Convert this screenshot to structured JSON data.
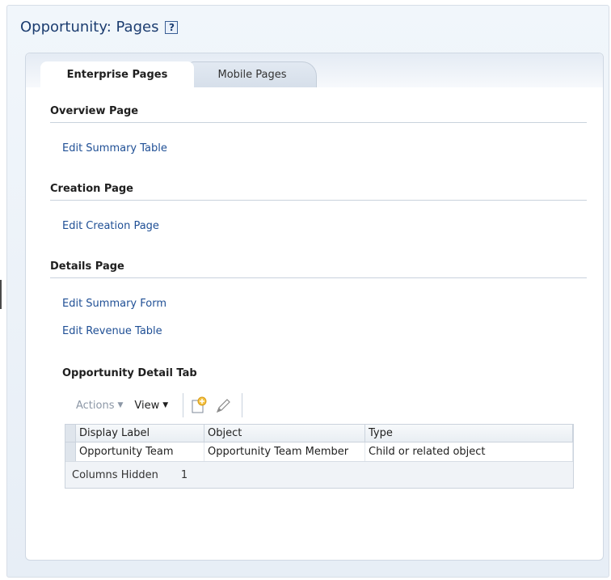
{
  "page": {
    "title": "Opportunity: Pages",
    "help_icon": "?"
  },
  "tabs": [
    {
      "label": "Enterprise Pages",
      "active": true
    },
    {
      "label": "Mobile Pages",
      "active": false
    }
  ],
  "sections": {
    "overview": {
      "title": "Overview Page",
      "links": [
        "Edit Summary Table"
      ]
    },
    "creation": {
      "title": "Creation Page",
      "links": [
        "Edit Creation Page"
      ]
    },
    "details": {
      "title": "Details Page",
      "links": [
        "Edit Summary Form",
        "Edit Revenue Table"
      ],
      "subsection_title": "Opportunity Detail Tab"
    }
  },
  "toolbar": {
    "actions_label": "Actions",
    "view_label": "View",
    "icons": [
      "create-icon",
      "edit-pencil-icon"
    ]
  },
  "table": {
    "columns": [
      "Display Label",
      "Object",
      "Type"
    ],
    "rows": [
      [
        "Opportunity Team",
        "Opportunity Team Member",
        "Child or related object"
      ]
    ],
    "footer": {
      "label": "Columns Hidden",
      "count": "1"
    }
  },
  "colors": {
    "link": "#1f4f95",
    "title": "#1c3d70"
  }
}
